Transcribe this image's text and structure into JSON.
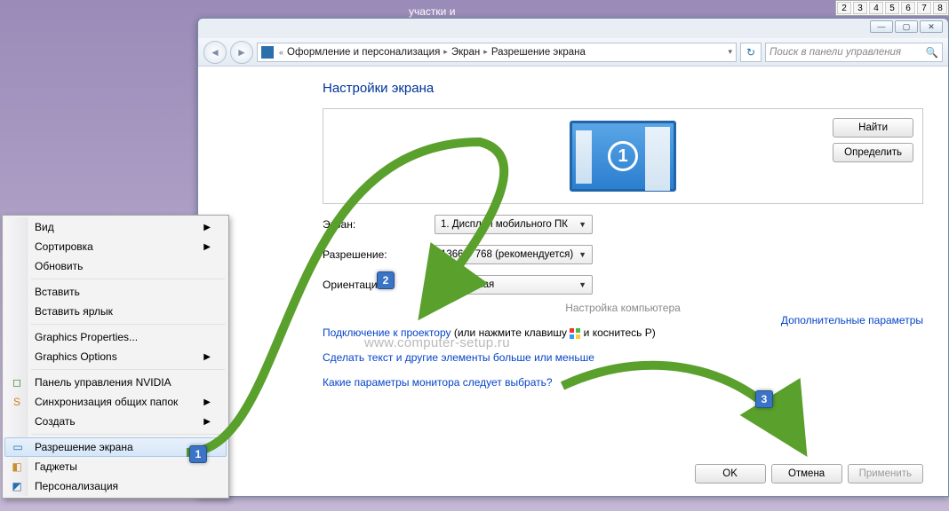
{
  "desktop": {
    "title_hint": "участки и",
    "sys_buttons": [
      "2",
      "3",
      "4",
      "5",
      "6",
      "7",
      "8"
    ]
  },
  "window": {
    "controls": {
      "min": "—",
      "max": "▢",
      "close": "✕"
    },
    "breadcrumb": {
      "level1": "Оформление и персонализация",
      "level2": "Экран",
      "level3": "Разрешение экрана"
    },
    "search_placeholder": "Поиск в панели управления",
    "section_title": "Настройки экрана",
    "monitor_number": "1",
    "buttons": {
      "find": "Найти",
      "identify": "Определить"
    },
    "fields": {
      "display_label": "Экран:",
      "display_value": "1. Дисплей мобильного ПК",
      "resolution_label": "Разрешение:",
      "resolution_value": "1366 × 768 (рекомендуется)",
      "orientation_label": "Ориентация:",
      "orientation_value": "Альбомная"
    },
    "subtitle": "Настройка компьютера",
    "advanced_link": "Дополнительные параметры",
    "projector_link": "Подключение к проектору",
    "projector_tail_a": " (или нажмите клавишу ",
    "projector_tail_b": " и коснитесь P)",
    "bigger_link": "Сделать текст и другие элементы больше или меньше",
    "which_link": "Какие параметры монитора следует выбрать?",
    "footer": {
      "ok": "OK",
      "cancel": "Отмена",
      "apply": "Применить"
    }
  },
  "context_menu": {
    "items": [
      {
        "label": "Вид",
        "arrow": true
      },
      {
        "label": "Сортировка",
        "arrow": true
      },
      {
        "label": "Обновить"
      },
      {
        "sep": true
      },
      {
        "label": "Вставить"
      },
      {
        "label": "Вставить ярлык"
      },
      {
        "sep": true
      },
      {
        "label": "Graphics Properties..."
      },
      {
        "label": "Graphics Options",
        "arrow": true
      },
      {
        "sep": true
      },
      {
        "label": "Панель управления NVIDIA",
        "icon": "nvidia"
      },
      {
        "label": "Синхронизация общих папок",
        "arrow": true,
        "icon": "sync"
      },
      {
        "label": "Создать",
        "arrow": true
      },
      {
        "sep": true
      },
      {
        "label": "Разрешение экрана",
        "icon": "screen",
        "selected": true
      },
      {
        "label": "Гаджеты",
        "icon": "gadget"
      },
      {
        "label": "Персонализация",
        "icon": "pers"
      }
    ]
  },
  "annotations": {
    "badge1": "1",
    "badge2": "2",
    "badge3": "3",
    "watermark": "www.computer-setup.ru"
  }
}
